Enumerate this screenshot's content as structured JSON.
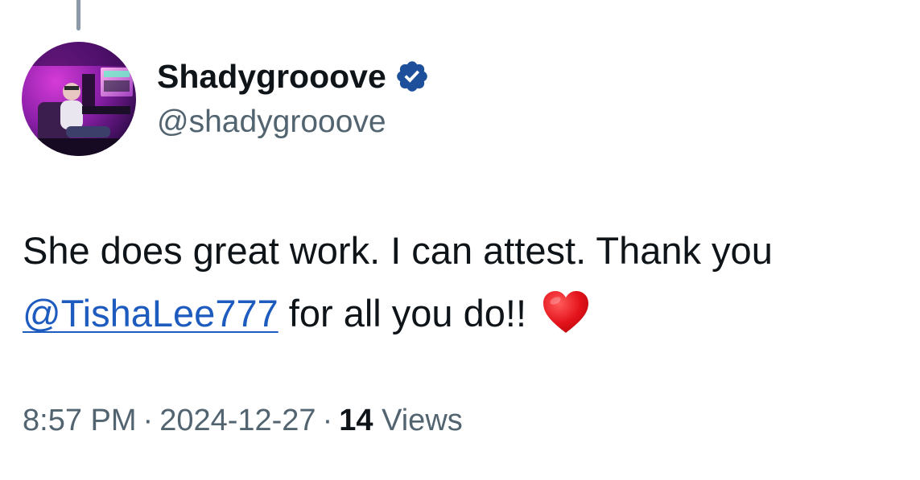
{
  "tweet": {
    "author": {
      "display_name": "Shadygrooove",
      "handle": "@shadygrooove",
      "verified_icon": "verified-badge-icon"
    },
    "text": {
      "line1": "She does great work. I can attest. Thank you",
      "mention": "@TishaLee777",
      "line2_rest": " for all you do!!",
      "emoji": "red-heart-icon"
    },
    "meta": {
      "time": "8:57 PM",
      "separator": "·",
      "date": "2024-12-27",
      "views_count": "14",
      "views_label": "Views"
    }
  },
  "colors": {
    "text_primary": "#0f1419",
    "text_secondary": "#536471",
    "mention": "#1d5bbf",
    "verified_badge": "#1d4f9a",
    "thread_line": "#8b98a5"
  }
}
